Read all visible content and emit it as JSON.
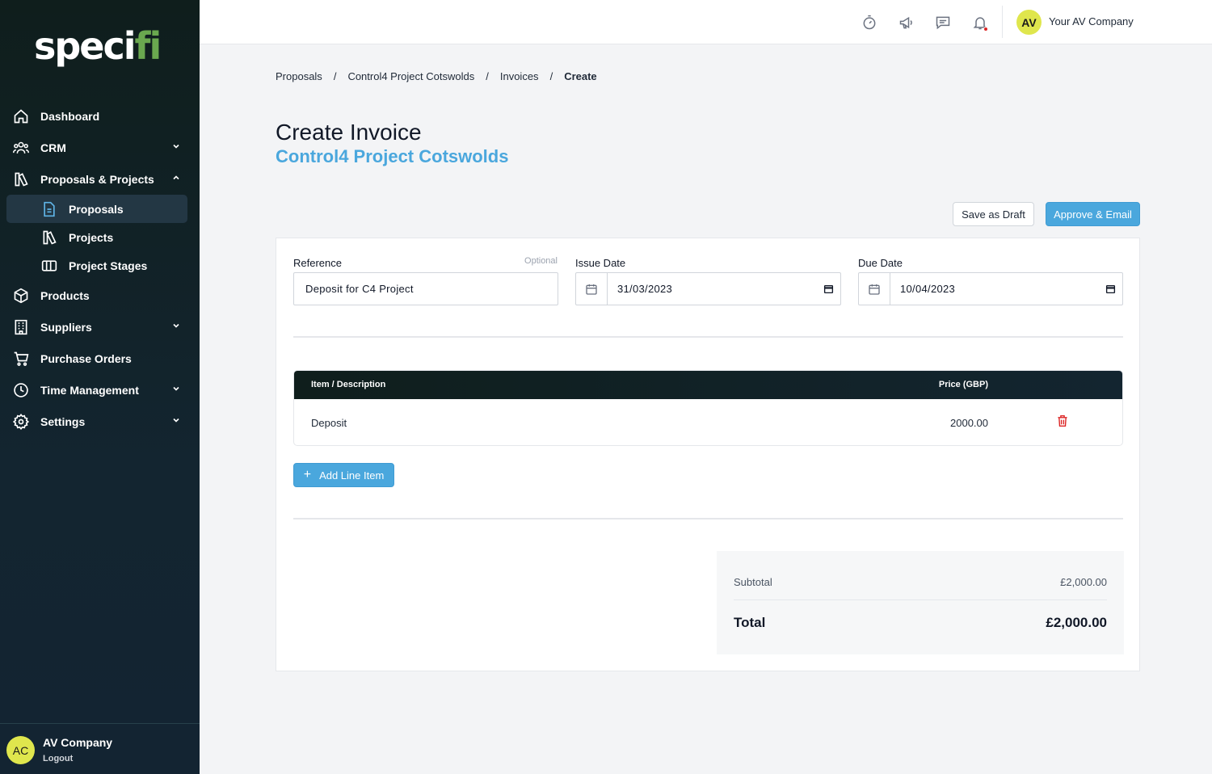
{
  "brand": {
    "logo_text": "speci",
    "logo_dot": "fi"
  },
  "sidebar": {
    "items": [
      {
        "label": "Dashboard",
        "icon": "home-icon"
      },
      {
        "label": "CRM",
        "icon": "users-icon",
        "expandable": true
      },
      {
        "label": "Proposals & Projects",
        "icon": "projects-icon",
        "expanded": true
      },
      {
        "label": "Products",
        "icon": "cube-icon"
      },
      {
        "label": "Suppliers",
        "icon": "building-icon",
        "expandable": true
      },
      {
        "label": "Purchase Orders",
        "icon": "cart-icon"
      },
      {
        "label": "Time Management",
        "icon": "clock-icon",
        "expandable": true
      },
      {
        "label": "Settings",
        "icon": "gear-icon",
        "expandable": true
      }
    ],
    "sub_items": [
      {
        "label": "Proposals",
        "icon": "document-icon",
        "active": true
      },
      {
        "label": "Projects",
        "icon": "projects-icon"
      },
      {
        "label": "Project Stages",
        "icon": "columns-icon"
      }
    ],
    "footer": {
      "initials": "AC",
      "name": "AV Company",
      "logout": "Logout"
    }
  },
  "topbar": {
    "icons": [
      "stopwatch-icon",
      "megaphone-icon",
      "chat-icon",
      "bell-icon"
    ],
    "avatar_initials": "AV",
    "company": "Your AV Company"
  },
  "breadcrumb": {
    "items": [
      "Proposals",
      "Control4 Project Cotswolds",
      "Invoices",
      "Create"
    ],
    "separator": "/"
  },
  "page": {
    "title": "Create Invoice",
    "subtitle": "Control4 Project Cotswolds"
  },
  "actions": {
    "save_draft": "Save as Draft",
    "approve_email": "Approve & Email"
  },
  "form": {
    "reference": {
      "label": "Reference",
      "optional": "Optional",
      "value": "Deposit for C4 Project"
    },
    "issue_date": {
      "label": "Issue Date",
      "value": "31/03/2023"
    },
    "due_date": {
      "label": "Due Date",
      "value": "10/04/2023"
    }
  },
  "line_items": {
    "headers": {
      "item": "Item / Description",
      "price": "Price (GBP)"
    },
    "rows": [
      {
        "description": "Deposit",
        "price": "2000.00"
      }
    ],
    "add_label": "Add Line Item"
  },
  "totals": {
    "subtotal_label": "Subtotal",
    "subtotal_value": "£2,000.00",
    "total_label": "Total",
    "total_value": "£2,000.00"
  },
  "colors": {
    "accent": "#4aa7dd",
    "sidebar_bg": "#132432",
    "delete": "#dc2626",
    "avatar": "#dfe64d"
  }
}
